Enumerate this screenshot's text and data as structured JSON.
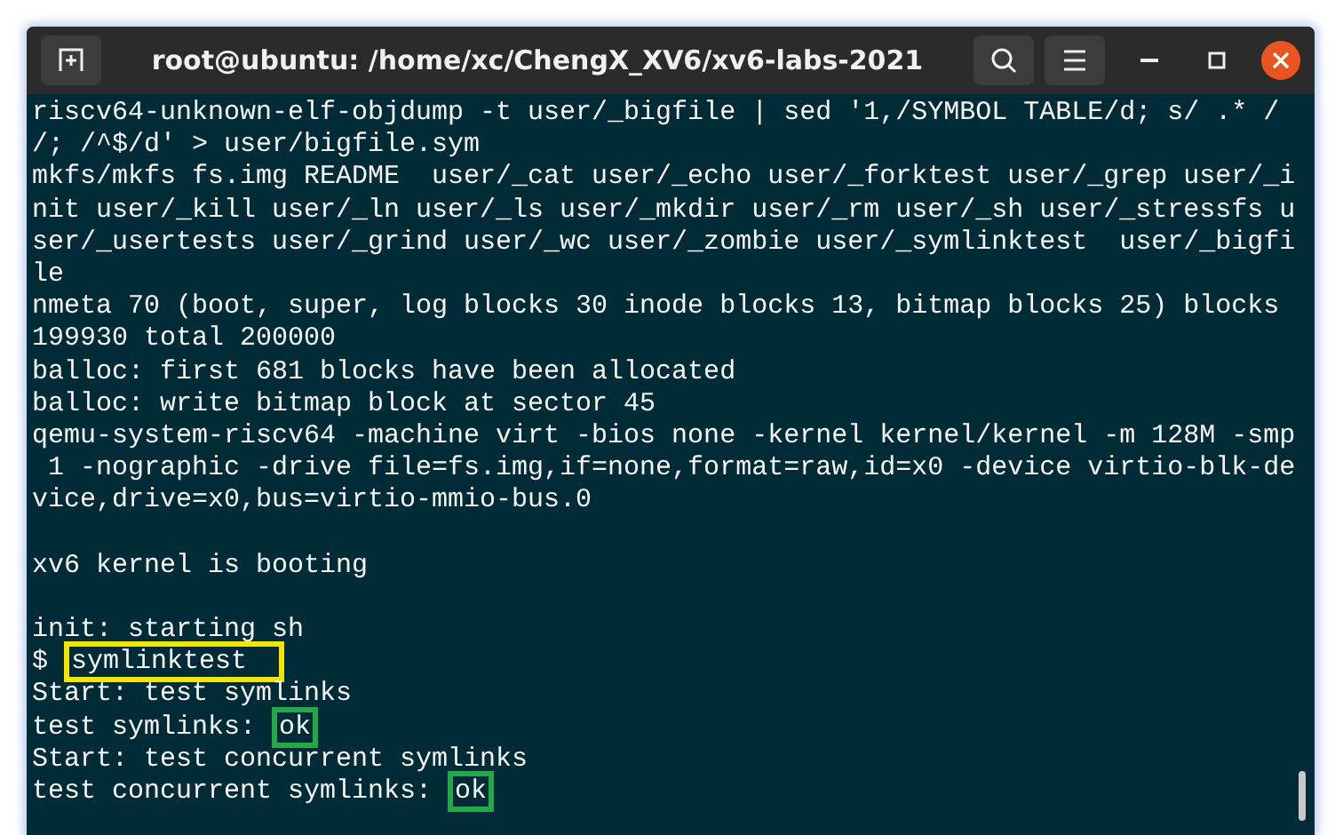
{
  "window": {
    "title": "root@ubuntu: /home/xc/ChengX_XV6/xv6-labs-2021"
  },
  "terminal": {
    "lines": [
      {
        "kind": "text",
        "segments": [
          {
            "text": "riscv64-unknown-elf-objdump -t user/_bigfile | sed '1,/SYMBOL TABLE/d; s/ .* /"
          }
        ]
      },
      {
        "kind": "text",
        "segments": [
          {
            "text": "/; /^$/d' > user/bigfile.sym"
          }
        ]
      },
      {
        "kind": "text",
        "segments": [
          {
            "text": "mkfs/mkfs fs.img README  user/_cat user/_echo user/_forktest user/_grep user/_i"
          }
        ]
      },
      {
        "kind": "text",
        "segments": [
          {
            "text": "nit user/_kill user/_ln user/_ls user/_mkdir user/_rm user/_sh user/_stressfs u"
          }
        ]
      },
      {
        "kind": "text",
        "segments": [
          {
            "text": "ser/_usertests user/_grind user/_wc user/_zombie user/_symlinktest  user/_bigfi"
          }
        ]
      },
      {
        "kind": "text",
        "segments": [
          {
            "text": "le"
          }
        ]
      },
      {
        "kind": "text",
        "segments": [
          {
            "text": "nmeta 70 (boot, super, log blocks 30 inode blocks 13, bitmap blocks 25) blocks"
          }
        ]
      },
      {
        "kind": "text",
        "segments": [
          {
            "text": "199930 total 200000"
          }
        ]
      },
      {
        "kind": "text",
        "segments": [
          {
            "text": "balloc: first 681 blocks have been allocated"
          }
        ]
      },
      {
        "kind": "text",
        "segments": [
          {
            "text": "balloc: write bitmap block at sector 45"
          }
        ]
      },
      {
        "kind": "text",
        "segments": [
          {
            "text": "qemu-system-riscv64 -machine virt -bios none -kernel kernel/kernel -m 128M -smp"
          }
        ]
      },
      {
        "kind": "text",
        "segments": [
          {
            "text": " 1 -nographic -drive file=fs.img,if=none,format=raw,id=x0 -device virtio-blk-de"
          }
        ]
      },
      {
        "kind": "text",
        "segments": [
          {
            "text": "vice,drive=x0,bus=virtio-mmio-bus.0"
          }
        ]
      },
      {
        "kind": "blank"
      },
      {
        "kind": "text",
        "segments": [
          {
            "text": "xv6 kernel is booting"
          }
        ]
      },
      {
        "kind": "blank"
      },
      {
        "kind": "text",
        "segments": [
          {
            "text": "init: starting sh"
          }
        ]
      },
      {
        "kind": "text",
        "segments": [
          {
            "text": "$ "
          },
          {
            "text": "symlinktest",
            "color": "#f2e600"
          }
        ]
      },
      {
        "kind": "text",
        "segments": [
          {
            "text": "Start: test symlinks"
          }
        ]
      },
      {
        "kind": "text",
        "segments": [
          {
            "text": "test symlinks: "
          },
          {
            "text": "ok",
            "color": "#22a846"
          }
        ]
      },
      {
        "kind": "text",
        "segments": [
          {
            "text": "Start: test concurrent symlinks"
          }
        ]
      },
      {
        "kind": "text",
        "segments": [
          {
            "text": "test concurrent symlinks: "
          },
          {
            "text": "ok",
            "color": "#22a846"
          }
        ]
      }
    ]
  }
}
